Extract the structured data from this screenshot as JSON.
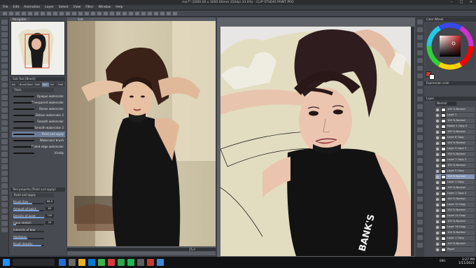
{
  "window": {
    "title": "ma7* (2000.00 x 3000.00mm 350dpi 33.0%) - CLIP STUDIO PAINT PRO"
  },
  "menu": [
    "File",
    "Edit",
    "Animation",
    "Layer",
    "Select",
    "View",
    "Filter",
    "Window",
    "Help"
  ],
  "navigator": {
    "tab": "Navigator"
  },
  "subtool": {
    "panel_title": "Sub Tool [Brush]",
    "tabs": [
      "Ink",
      "Brush",
      "Real",
      "Soft",
      "Wat",
      "Ink",
      "Feel"
    ],
    "group": "Thick",
    "brushes": [
      {
        "label": "Opaque watercolor",
        "selected": false
      },
      {
        "label": "Transparent watercolor",
        "selected": false
      },
      {
        "label": "Dense watercolor",
        "selected": false
      },
      {
        "label": "Deluxe watercolor 2",
        "selected": false
      },
      {
        "label": "Smooth watercolor",
        "selected": false
      },
      {
        "label": "Smooth watercolor 2",
        "selected": false
      },
      {
        "label": "Paint and apply",
        "selected": true
      },
      {
        "label": "Watercolor brush",
        "selected": false
      },
      {
        "label": "Flated edge watercolor",
        "selected": false
      },
      {
        "label": "Vividly",
        "selected": false
      }
    ]
  },
  "tool_property": {
    "title": "Tool property [Paint and apply]",
    "name": "Paint and apply",
    "props": [
      {
        "label": "Brush Size",
        "value": "68.0",
        "level": 0.62
      },
      {
        "label": "Amount of paint",
        "value": "83",
        "level": 0.83
      },
      {
        "label": "Density of paint",
        "value": "100",
        "level": 1.0
      },
      {
        "label": "Color stretch",
        "value": "10",
        "level": 0.1
      },
      {
        "label": "Intensity of blur",
        "value": "",
        "level": 0.0
      },
      {
        "label": "Hardness",
        "value": "",
        "level": 0.45
      },
      {
        "label": "Brush density",
        "value": "",
        "level": 0.9
      }
    ]
  },
  "reference_tab": "Sub View",
  "canvas_zoom": "25.0",
  "color_panel": {
    "title": "Color Wheel",
    "accent": "#c0403c"
  },
  "layer_panel": {
    "title": "Layer",
    "blend": "Normal",
    "subtitle": "Expression color",
    "layers": [
      {
        "label": "100 % Normal",
        "selected": false
      },
      {
        "label": "Layer 1",
        "selected": false
      },
      {
        "label": "100 % Normal",
        "selected": false
      },
      {
        "label": "Folder 1 Copy 2",
        "selected": false
      },
      {
        "label": "100 % Normal",
        "selected": false
      },
      {
        "label": "Layer 8 Copy",
        "selected": false
      },
      {
        "label": "100 % Normal",
        "selected": false
      },
      {
        "label": "Layer 9 Copy 2",
        "selected": false
      },
      {
        "label": "100 % Normal",
        "selected": false
      },
      {
        "label": "Layer 7 Copy 2",
        "selected": false
      },
      {
        "label": "100 % Normal",
        "selected": false
      },
      {
        "label": "Layer 5 Copy",
        "selected": false
      },
      {
        "label": "100 % Normal",
        "selected": true
      },
      {
        "label": "Layer 1 Copy",
        "selected": false
      },
      {
        "label": "100 % Normal",
        "selected": false
      },
      {
        "label": "Layer 1 Copy 2",
        "selected": false
      },
      {
        "label": "100 % Normal",
        "selected": false
      },
      {
        "label": "Layer 10 Copy",
        "selected": false
      },
      {
        "label": "100 % Normal",
        "selected": false
      },
      {
        "label": "Layer 14 Copy",
        "selected": false
      },
      {
        "label": "100 % Normal",
        "selected": false
      },
      {
        "label": "Layer 16 Copy",
        "selected": false
      },
      {
        "label": "100 % Normal",
        "selected": false
      },
      {
        "label": "Layer 1 Copy",
        "selected": false
      },
      {
        "label": "100 % Normal",
        "selected": false
      },
      {
        "label": "Paper",
        "selected": false
      }
    ]
  },
  "signature": "BANK'S",
  "taskbar": {
    "time": "3:27 PM",
    "date": "1/11/2021",
    "lang": "ENG"
  }
}
